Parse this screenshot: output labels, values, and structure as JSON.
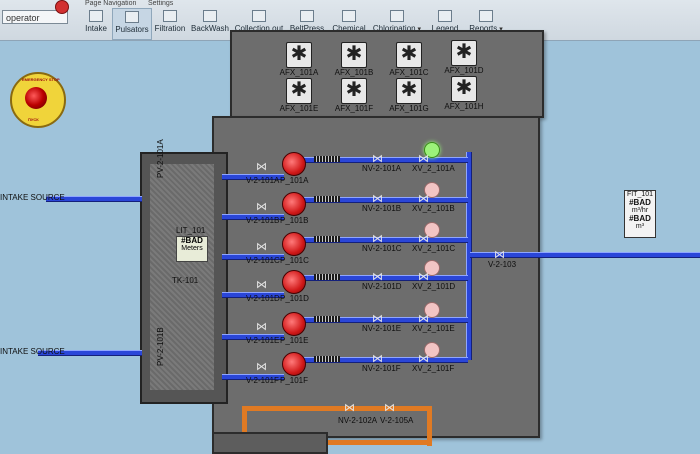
{
  "topbar": {
    "user": "operator",
    "page_nav_group": "Page Navigation",
    "settings_group": "Settings",
    "nav_items": [
      {
        "label": "Intake"
      },
      {
        "label": "Pulsators",
        "active": true
      },
      {
        "label": "Filtration"
      },
      {
        "label": "BackWash"
      },
      {
        "label": "Collection out"
      },
      {
        "label": "BeltPress"
      },
      {
        "label": "Chemical"
      },
      {
        "label": "Chlorination"
      },
      {
        "label": "Legend"
      },
      {
        "label": "Reports"
      }
    ]
  },
  "estop": {
    "text_top": "EMERGENCY STOP",
    "text_bottom": "ПУСК"
  },
  "fans": [
    "AFX_101A",
    "AFX_101B",
    "AFX_101C",
    "AFX_101D",
    "AFX_101E",
    "AFX_101F",
    "AFX_101G",
    "AFX_101H"
  ],
  "tank": {
    "name": "TK-101",
    "lit": {
      "tag": "LIT_101",
      "value": "#BAD",
      "unit": "Meters"
    },
    "inlet_valves": [
      "PV-2-101A",
      "PV-2-101B"
    ]
  },
  "intake_labels": [
    "INTAKE SOURCE",
    "INTAKE SOURCE"
  ],
  "rows": [
    {
      "valve_in": "V-2-101A",
      "pump": "P_101A",
      "nv": "NV-2-101A",
      "xv": "XV_2_101A",
      "xv_on": true
    },
    {
      "valve_in": "V-2-101B",
      "pump": "P_101B",
      "nv": "NV-2-101B",
      "xv": "XV_2_101B",
      "xv_on": false
    },
    {
      "valve_in": "V-2-101C",
      "pump": "P_101C",
      "nv": "NV-2-101C",
      "xv": "XV_2_101C",
      "xv_on": false
    },
    {
      "valve_in": "V-2-101D",
      "pump": "P_101D",
      "nv": "NV-2-101D",
      "xv": "XV_2_101D",
      "xv_on": false
    },
    {
      "valve_in": "V-2-101E",
      "pump": "P_101E",
      "nv": "NV-2-101E",
      "xv": "XV_2_101E",
      "xv_on": false
    },
    {
      "valve_in": "V-2-101F",
      "pump": "P_101F",
      "nv": "NV-2-101F",
      "xv": "XV_2_101F",
      "xv_on": false
    }
  ],
  "outlet": {
    "valve": "V-2-103"
  },
  "fit": {
    "tag": "FIT_101",
    "value1": "#BAD",
    "unit1": "m³/hr",
    "value2": "#BAD",
    "unit2": "m³"
  },
  "overflow": {
    "nv": "NV-2-102A",
    "v": "V-2-105A"
  },
  "colors": {
    "pipe": "#2a46d8",
    "overflow_pipe": "#e07a23",
    "background": "#9fc3da",
    "panel": "#6d6d6d"
  }
}
